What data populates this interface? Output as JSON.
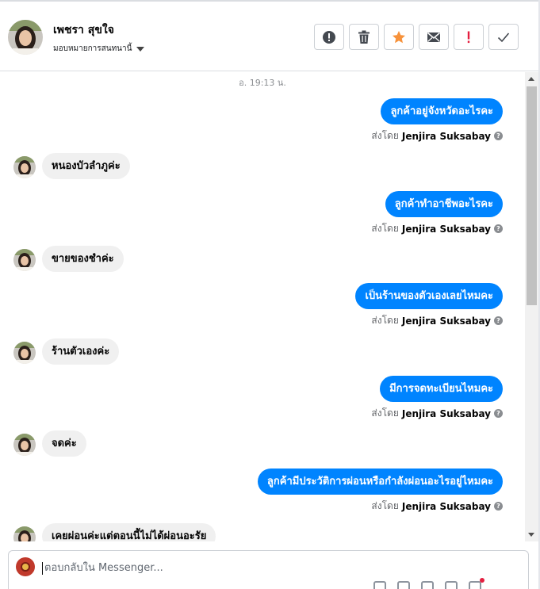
{
  "header": {
    "contact_name": "เพชรา สุขใจ",
    "assign_label": "มอบหมายการสนทนานี้"
  },
  "actions": [
    {
      "icon": "alert-icon",
      "color": "#444950"
    },
    {
      "icon": "trash-icon",
      "color": "#444950"
    },
    {
      "icon": "star-icon",
      "color": "#f7923b"
    },
    {
      "icon": "envelope-icon",
      "color": "#444950"
    },
    {
      "icon": "spam-icon",
      "color": "#e41e3f"
    },
    {
      "icon": "check-icon",
      "color": "#444950"
    }
  ],
  "chat": {
    "timestamp": "อ. 19:13 น.",
    "sent_by_prefix": "ส่งโดย",
    "agent_name": "Jenjira Suksabay",
    "messages": [
      {
        "dir": "out",
        "text": "ลูกค้าอยู่จังหวัดอะไรคะ"
      },
      {
        "dir": "in",
        "text": "หนองบัวลำภูค่ะ"
      },
      {
        "dir": "out",
        "text": "ลูกค้าทำอาชีพอะไรคะ"
      },
      {
        "dir": "in",
        "text": "ขายของชำค่ะ"
      },
      {
        "dir": "out",
        "text": "เป็นร้านของตัวเองเลยไหมคะ"
      },
      {
        "dir": "in",
        "text": "ร้านตัวเองค่ะ"
      },
      {
        "dir": "out",
        "text": "มีการจดทะเบียนไหมคะ"
      },
      {
        "dir": "in",
        "text": "จดค่ะ"
      },
      {
        "dir": "out",
        "text": "ลูกค้ามีประวัติการผ่อนหรือกำลังผ่อนอะไรอยู่ไหมคะ"
      },
      {
        "dir": "in",
        "text": "เคยผ่อนค่ะแต่ตอนนี้ไม่ได้ผ่อนอะรัย"
      }
    ]
  },
  "compose": {
    "placeholder": "ตอบกลับใน Messenger..."
  },
  "colors": {
    "accent_blue": "#0084ff",
    "incoming_bubble": "#f0f0f0"
  }
}
